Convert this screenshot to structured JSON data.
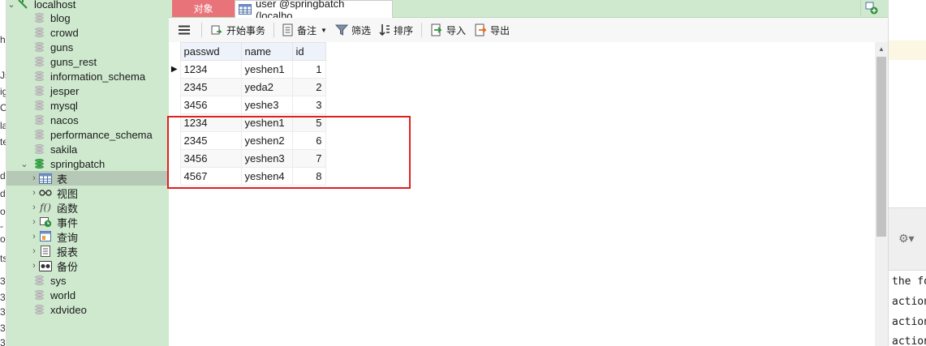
{
  "left_strip": [
    "h",
    "Js",
    "ig",
    "Ob",
    "la",
    "te",
    "d",
    "d",
    "o",
    "-",
    "o",
    "ts",
    "3",
    "3",
    "3",
    "3",
    "3"
  ],
  "tree": {
    "root": "localhost",
    "items": [
      {
        "label": "blog"
      },
      {
        "label": "crowd"
      },
      {
        "label": "guns"
      },
      {
        "label": "guns_rest"
      },
      {
        "label": "information_schema"
      },
      {
        "label": "jesper"
      },
      {
        "label": "mysql"
      },
      {
        "label": "nacos"
      },
      {
        "label": "performance_schema"
      },
      {
        "label": "sakila"
      },
      {
        "label": "springbatch"
      }
    ],
    "children": [
      {
        "label": "表",
        "icon": "table-icon"
      },
      {
        "label": "视图",
        "icon": "view-icon"
      },
      {
        "label": "函数",
        "icon": "function-icon"
      },
      {
        "label": "事件",
        "icon": "event-icon"
      },
      {
        "label": "查询",
        "icon": "query-icon"
      },
      {
        "label": "报表",
        "icon": "report-icon"
      },
      {
        "label": "备份",
        "icon": "backup-icon"
      }
    ],
    "after": [
      {
        "label": "sys"
      },
      {
        "label": "world"
      },
      {
        "label": "xdvideo"
      }
    ]
  },
  "tabs": {
    "objects": "对象",
    "active": "user @springbatch (localho..."
  },
  "toolbar": {
    "begin_transaction": "开始事务",
    "memo": "备注",
    "filter": "筛选",
    "sort": "排序",
    "import": "导入",
    "export": "导出"
  },
  "grid": {
    "columns": [
      "passwd",
      "name",
      "id"
    ],
    "rows": [
      [
        "1234",
        "yeshen1",
        "1"
      ],
      [
        "2345",
        "yeda2",
        "2"
      ],
      [
        "3456",
        "yeshe3",
        "3"
      ],
      [
        "1234",
        "yeshen1",
        "5"
      ],
      [
        "2345",
        "yeshen2",
        "6"
      ],
      [
        "3456",
        "yeshen3",
        "7"
      ],
      [
        "4567",
        "yeshen4",
        "8"
      ]
    ]
  },
  "right_panel": {
    "lines": [
      "the fo",
      "action",
      "action",
      "action"
    ]
  },
  "colors": {
    "nav_bg": "#cfe9cf",
    "objects_tab": "#e8747a",
    "highlight_box": "#e1201e",
    "header_bg": "#eef3fb"
  }
}
